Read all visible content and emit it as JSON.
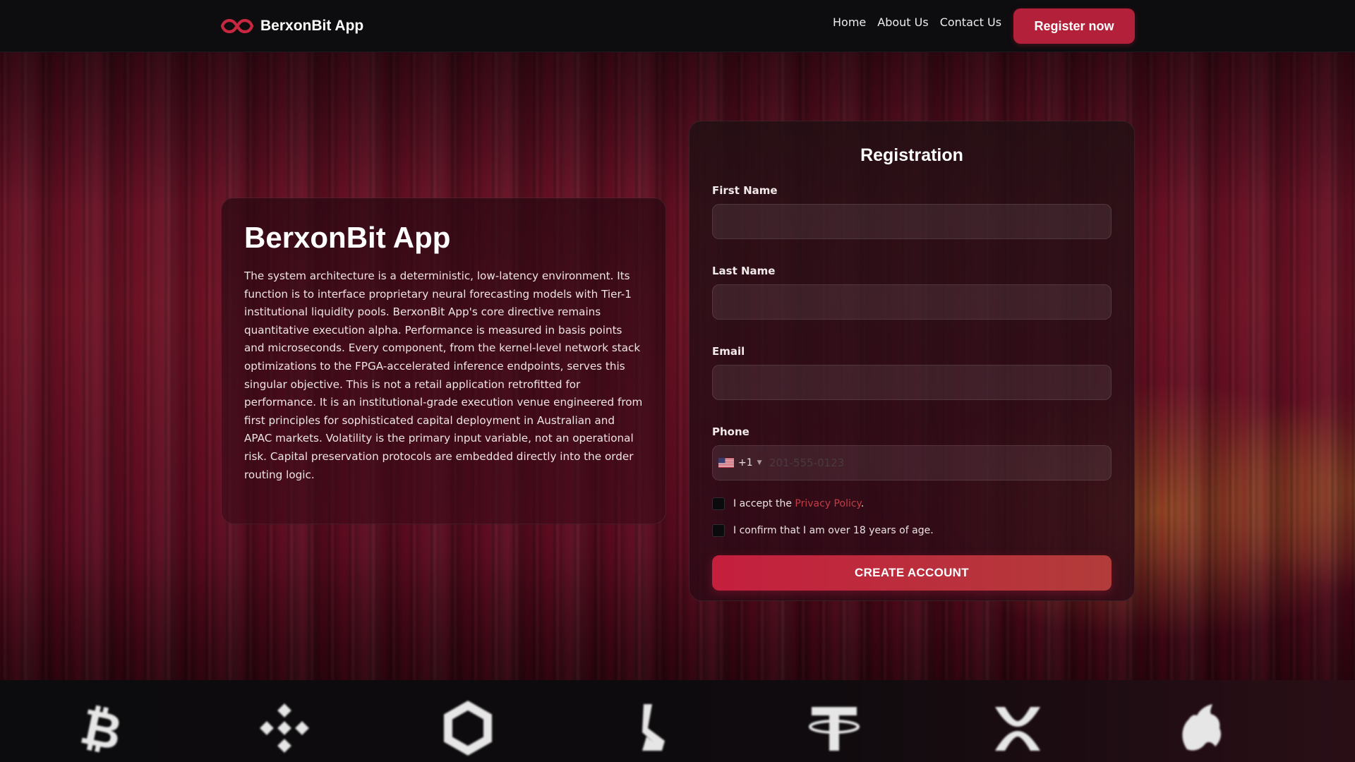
{
  "header": {
    "brand": "BerxonBit App",
    "nav": [
      "Home",
      "About Us",
      "Contact Us"
    ],
    "cta": "Register now"
  },
  "info": {
    "title": "BerxonBit App",
    "body": "The system architecture is a deterministic, low-latency environment. Its function is to interface proprietary neural forecasting models with Tier-1 institutional liquidity pools. BerxonBit App's core directive remains quantitative execution alpha. Performance is measured in basis points and microseconds. Every component, from the kernel-level network stack optimizations to the FPGA-accelerated inference endpoints, serves this singular objective. This is not a retail application retrofitted for performance. It is an institutional-grade execution venue engineered from first principles for sophisticated capital deployment in Australian and APAC markets. Volatility is the primary input variable, not an operational risk. Capital preservation protocols are embedded directly into the order routing logic."
  },
  "form": {
    "title": "Registration",
    "first_name_label": "First Name",
    "last_name_label": "Last Name",
    "email_label": "Email",
    "phone_label": "Phone",
    "phone_country_code": "+1",
    "phone_placeholder": "201-555-0123",
    "privacy_prefix": "I accept the",
    "privacy_link": "Privacy Policy",
    "privacy_suffix": ".",
    "age_confirm": "I confirm that I am over 18 years of age.",
    "submit": "CREATE ACCOUNT"
  },
  "coins": [
    "bitcoin-icon",
    "binance-icon",
    "chainlink-icon",
    "lisk-icon",
    "tether-icon",
    "xrp-icon",
    "uniswap-icon"
  ],
  "colors": {
    "accent": "#b3203a",
    "link": "#c23d46",
    "header_bg": "#0d0c0e"
  }
}
